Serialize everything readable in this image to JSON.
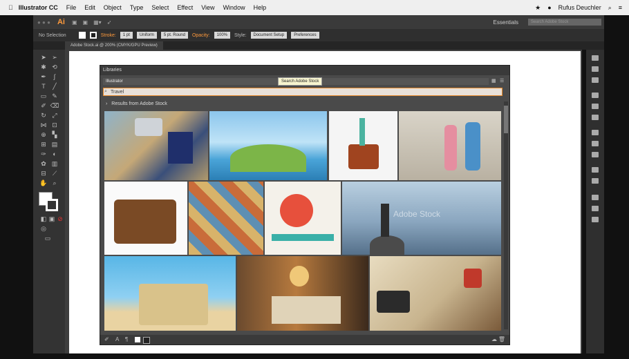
{
  "menubar": {
    "apple": "",
    "app_name": "Illustrator CC",
    "items": [
      "File",
      "Edit",
      "Object",
      "Type",
      "Select",
      "Effect",
      "View",
      "Window",
      "Help"
    ],
    "user": "Rufus Deuchler"
  },
  "appbar": {
    "logo": "Ai",
    "workspace": "Essentials",
    "stock_search_placeholder": "Search Adobe Stock"
  },
  "control_bar": {
    "selection": "No Selection",
    "stroke_label": "Stroke:",
    "stroke_value": "1 pt",
    "uniform": "Uniform",
    "brush": "5 pt. Round",
    "opacity_label": "Opacity:",
    "opacity_value": "100%",
    "style_label": "Style:",
    "document_setup": "Document Setup",
    "preferences": "Preferences"
  },
  "document_tab": {
    "label": "Adobe Stock.ai @ 200% (CMYK/GPU Preview)"
  },
  "libraries": {
    "title": "Libraries",
    "library_name": "Illustrator",
    "search_value": "Travel",
    "results_header": "Results from Adobe Stock",
    "tooltip": "Search Adobe Stock",
    "watermark": "Adobe Stock"
  },
  "colors": {
    "accent_orange": "#e88a2a",
    "panel_bg": "#4a4a4a",
    "tooltip_bg": "#f7f4cf"
  }
}
